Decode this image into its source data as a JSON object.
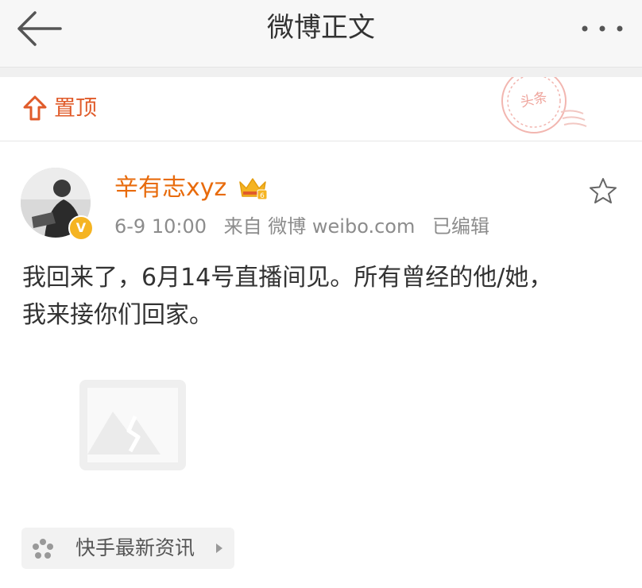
{
  "header": {
    "title": "微博正文"
  },
  "pinned": {
    "label": "置顶",
    "stamp_text": "头条"
  },
  "post": {
    "author": "辛有志xyz",
    "timestamp": "6-9 10:00",
    "source": "来自 微博 weibo.com",
    "edited": "已编辑",
    "text": "我回来了，6月14号直播间见。所有曾经的他/她，我来接你们回家。",
    "text_line1": "我回来了，6月14号直播间见。所有曾经的他/她，",
    "text_line2": "我来接你们回家。",
    "verified_badge": "V"
  },
  "tag": {
    "label": "快手最新资讯"
  },
  "colors": {
    "accent": "#e86b0c",
    "pinned": "#e05b2a",
    "verified": "#f5b422"
  },
  "icons": [
    "back-arrow-icon",
    "more-icon",
    "pin-top-icon",
    "stamp-icon",
    "crown-icon",
    "star-icon",
    "image-placeholder-icon",
    "kuaishou-icon",
    "chevron-right-icon"
  ]
}
